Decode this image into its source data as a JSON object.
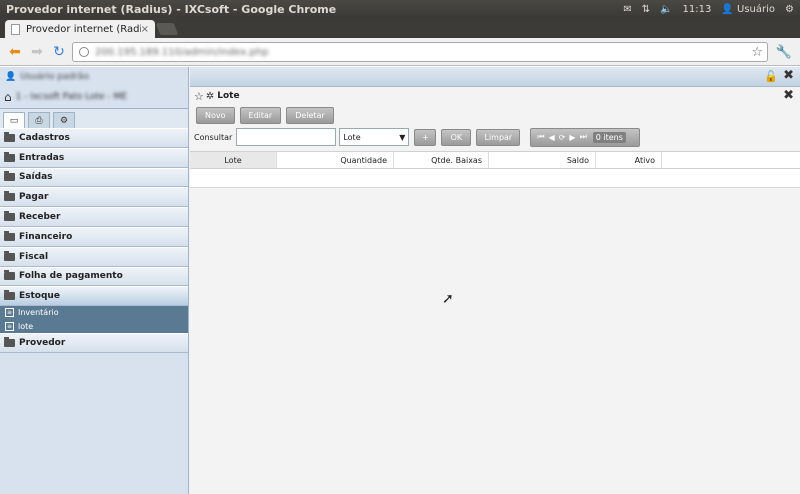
{
  "os": {
    "window_title": "Provedor internet (Radius) - IXCsoft - Google Chrome",
    "clock": "11:13",
    "user": "Usuário"
  },
  "browser": {
    "tab_title": "Provedor internet (Radius)",
    "tab_close": "×",
    "url": "200.195.189.110/admin/index.php"
  },
  "sidebar": {
    "user_label": "Usuário padrão",
    "home_label": "1 - Ixcsoft Pato Lote - ME",
    "menu": [
      {
        "label": "Cadastros"
      },
      {
        "label": "Entradas"
      },
      {
        "label": "Saídas"
      },
      {
        "label": "Pagar"
      },
      {
        "label": "Receber"
      },
      {
        "label": "Financeiro"
      },
      {
        "label": "Fiscal"
      },
      {
        "label": "Folha de pagamento"
      },
      {
        "label": "Estoque"
      }
    ],
    "estoque_sub": [
      {
        "label": "Inventário"
      },
      {
        "label": "lote"
      }
    ],
    "menu_after": [
      {
        "label": "Provedor"
      }
    ]
  },
  "panel": {
    "title": "Lote",
    "buttons": {
      "novo": "Novo",
      "editar": "Editar",
      "deletar": "Deletar"
    },
    "search": {
      "label": "Consultar",
      "value": "",
      "select_value": "Lote",
      "plus": "+",
      "ok": "OK",
      "limpar": "Limpar"
    },
    "pager": {
      "count": "0 itens"
    },
    "columns": [
      "Lote",
      "Quantidade",
      "Qtde. Baixas",
      "Saldo",
      "Ativo"
    ]
  }
}
